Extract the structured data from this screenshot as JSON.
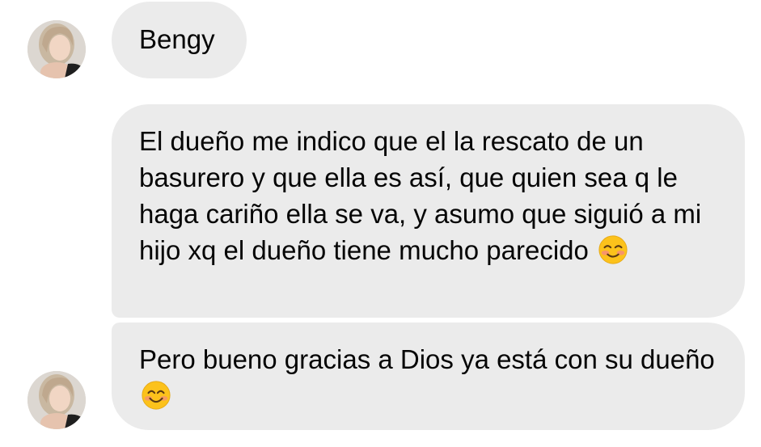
{
  "messages": [
    {
      "text": "Bengy"
    },
    {
      "text": "El dueño me indico que el la rescato de un basurero y que ella es así, que quien sea q le haga cariño ella se va, y asumo que siguió a mi hijo xq el dueño tiene mucho parecido",
      "emoji": "smiling-face-with-blush-icon"
    },
    {
      "text": "Pero bueno gracias a Dios ya está con su dueño",
      "emoji": "smiling-face-icon"
    }
  ],
  "colors": {
    "bubble": "#ebebeb",
    "text": "#050505",
    "background": "#ffffff"
  }
}
